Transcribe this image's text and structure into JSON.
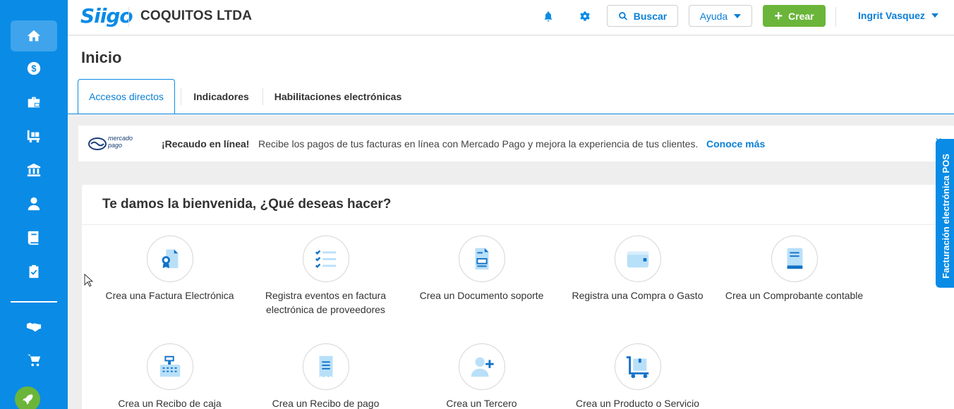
{
  "app": {
    "logo_text": "Siigo",
    "company": "COQUITOS LTDA"
  },
  "header": {
    "bell_icon": "bell-icon",
    "settings_icon": "gear-icon",
    "search_label": "Buscar",
    "help_label": "Ayuda",
    "create_label": "Crear",
    "user_name": "Ingrit Vasquez"
  },
  "sidebar": {
    "items": [
      {
        "icon": "home-icon"
      },
      {
        "icon": "dollar-icon"
      },
      {
        "icon": "briefcase-icon"
      },
      {
        "icon": "cart-icon"
      },
      {
        "icon": "bank-icon"
      },
      {
        "icon": "person-icon"
      },
      {
        "icon": "book-icon"
      },
      {
        "icon": "clipboard-check-icon"
      },
      {
        "icon": "handshake-icon"
      },
      {
        "icon": "shopping-cart-icon"
      },
      {
        "icon": "rocket-icon"
      }
    ]
  },
  "page": {
    "title": "Inicio",
    "tabs": [
      {
        "label": "Accesos directos",
        "active": true
      },
      {
        "label": "Indicadores",
        "active": false
      },
      {
        "label": "Habilitaciones electrónicas",
        "active": false
      }
    ]
  },
  "banner": {
    "logo_text": "mercado pago",
    "headline": "¡Recaudo en línea!",
    "text": "Recibe los pagos de tus facturas en línea con Mercado Pago y mejora la experiencia de tus clientes.",
    "link": "Conoce más"
  },
  "welcome": {
    "title": "Te damos la bienvenida, ¿Qué deseas hacer?",
    "actions": [
      {
        "label": "Crea una Factura Electrónica",
        "icon": "invoice-icon"
      },
      {
        "label": "Registra eventos en factura electrónica de proveedores",
        "icon": "checklist-icon"
      },
      {
        "label": "Crea un Documento soporte",
        "icon": "document-icon"
      },
      {
        "label": "Registra una Compra o Gasto",
        "icon": "wallet-icon"
      },
      {
        "label": "Crea un Comprobante contable",
        "icon": "ledger-icon"
      },
      {
        "label": "Crea un Recibo de caja",
        "icon": "cash-register-icon"
      },
      {
        "label": "Crea un Recibo de pago",
        "icon": "receipt-icon"
      },
      {
        "label": "Crea un Tercero",
        "icon": "add-user-icon"
      },
      {
        "label": "Crea un Producto o Servicio",
        "icon": "product-cart-icon"
      }
    ]
  },
  "pos_tab": {
    "label": "Facturación electrónica POS"
  },
  "colors": {
    "brand": "#0a8be6",
    "create": "#6bb53a",
    "icon_light": "#b9e0f9",
    "icon_dark": "#1272c7"
  }
}
